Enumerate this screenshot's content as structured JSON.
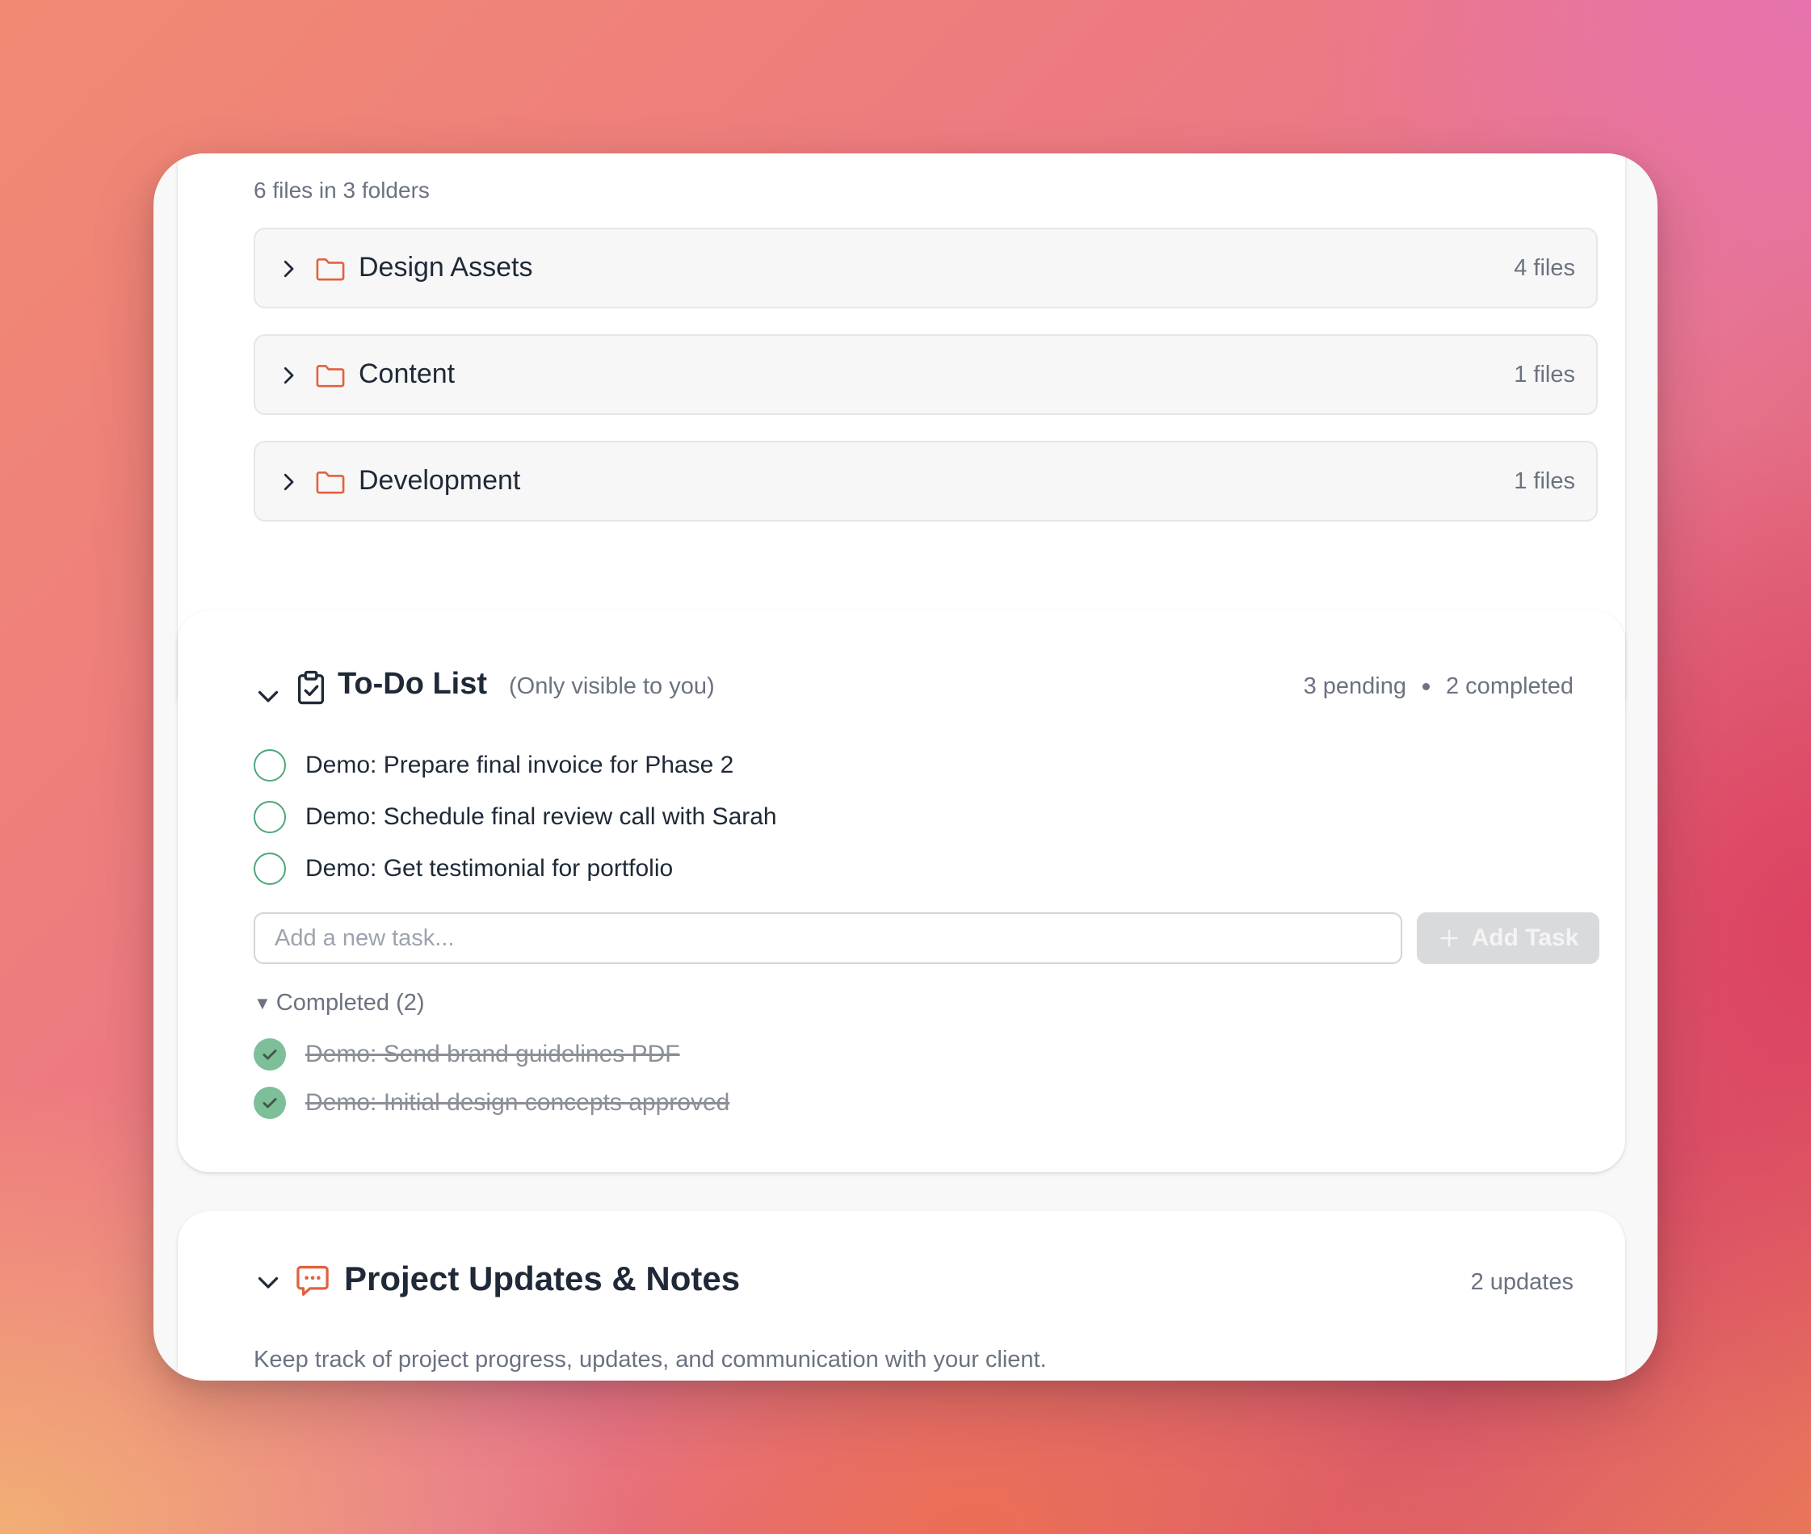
{
  "files": {
    "summary": "6 files in 3 folders",
    "folders": [
      {
        "name": "Design Assets",
        "count": "4 files"
      },
      {
        "name": "Content",
        "count": "1 files"
      },
      {
        "name": "Development",
        "count": "1 files"
      }
    ]
  },
  "todo": {
    "title": "To-Do List",
    "visibility": "(Only visible to you)",
    "pending": "3 pending",
    "completed_count": "2 completed",
    "tasks": [
      {
        "label": "Demo: Prepare final invoice for Phase 2"
      },
      {
        "label": "Demo: Schedule final review call with Sarah"
      },
      {
        "label": "Demo: Get testimonial for portfolio"
      }
    ],
    "input_placeholder": "Add a new task...",
    "add_button": "Add Task",
    "completed_toggle": "Completed (2)",
    "completed_tasks": [
      {
        "label": "Demo: Send brand guidelines PDF"
      },
      {
        "label": "Demo: Initial design concepts approved"
      }
    ]
  },
  "updates": {
    "title": "Project Updates & Notes",
    "count": "2 updates",
    "description": "Keep track of project progress, updates, and communication with your client."
  },
  "colors": {
    "accent": "#e0623f",
    "check_green": "#4ba877",
    "done_green": "#7dbf99"
  },
  "icons": {
    "folder": "folder-icon",
    "chevron_right": "chevron-right-icon",
    "chevron_down": "chevron-down-icon",
    "clipboard_check": "clipboard-check-icon",
    "message": "message-icon",
    "plus": "plus-icon",
    "check": "check-icon"
  }
}
